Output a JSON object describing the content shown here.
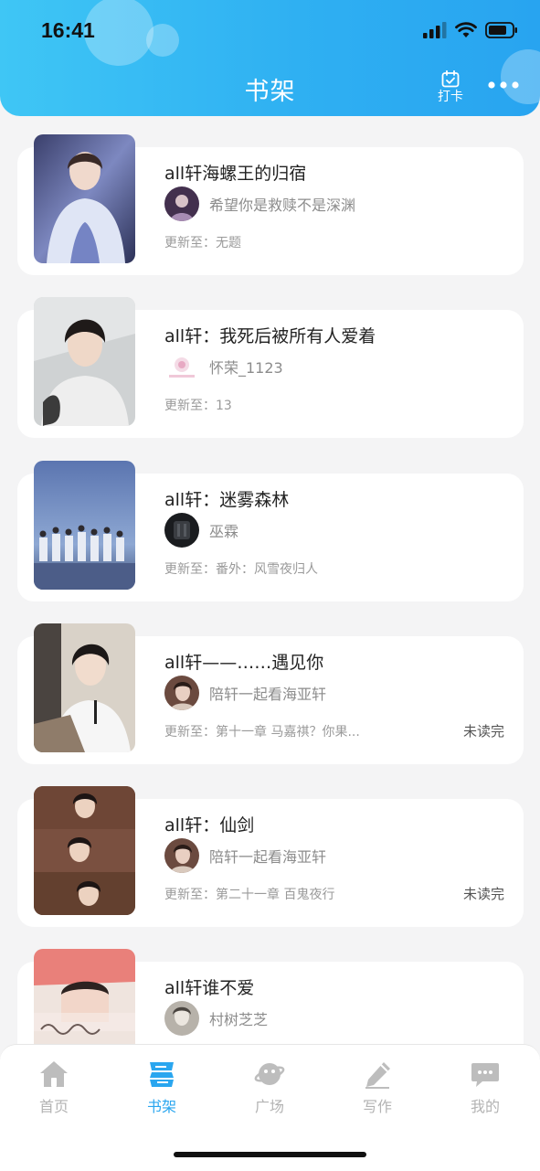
{
  "status_bar": {
    "time": "16:41"
  },
  "header": {
    "title": "书架",
    "checkin_label": "打卡"
  },
  "books": [
    {
      "title": "all轩海螺王的归宿",
      "author": "希望你是救赎不是深渊",
      "update_prefix": "更新至：",
      "update": "无题",
      "unread": ""
    },
    {
      "title": "all轩：我死后被所有人爱着",
      "author": "怀荣_1123",
      "update_prefix": "更新至：",
      "update": "13",
      "unread": ""
    },
    {
      "title": "all轩：迷雾森林",
      "author": "巫霖",
      "update_prefix": "更新至：",
      "update": "番外：风雪夜归人",
      "unread": ""
    },
    {
      "title": "all轩——……遇见你",
      "author": "陪轩一起看海亚轩",
      "update_prefix": "更新至：",
      "update": "第十一章 马嘉祺？你果...",
      "unread": "未读完"
    },
    {
      "title": "all轩：仙剑",
      "author": "陪轩一起看海亚轩",
      "update_prefix": "更新至：",
      "update": "第二十一章  百鬼夜行",
      "unread": "未读完"
    },
    {
      "title": "all轩谁不爱",
      "author": "村树芝芝",
      "update_prefix": "",
      "update": "",
      "unread": ""
    }
  ],
  "tabs": [
    {
      "label": "首页",
      "icon": "home-icon"
    },
    {
      "label": "书架",
      "icon": "bookshelf-icon"
    },
    {
      "label": "广场",
      "icon": "planet-icon"
    },
    {
      "label": "写作",
      "icon": "pen-icon"
    },
    {
      "label": "我的",
      "icon": "chat-bubble-icon"
    }
  ],
  "colors": {
    "accent": "#2aa6ef",
    "header_start": "#3fc6f5",
    "header_end": "#28a4f0",
    "inactive": "#b3b3b3"
  }
}
